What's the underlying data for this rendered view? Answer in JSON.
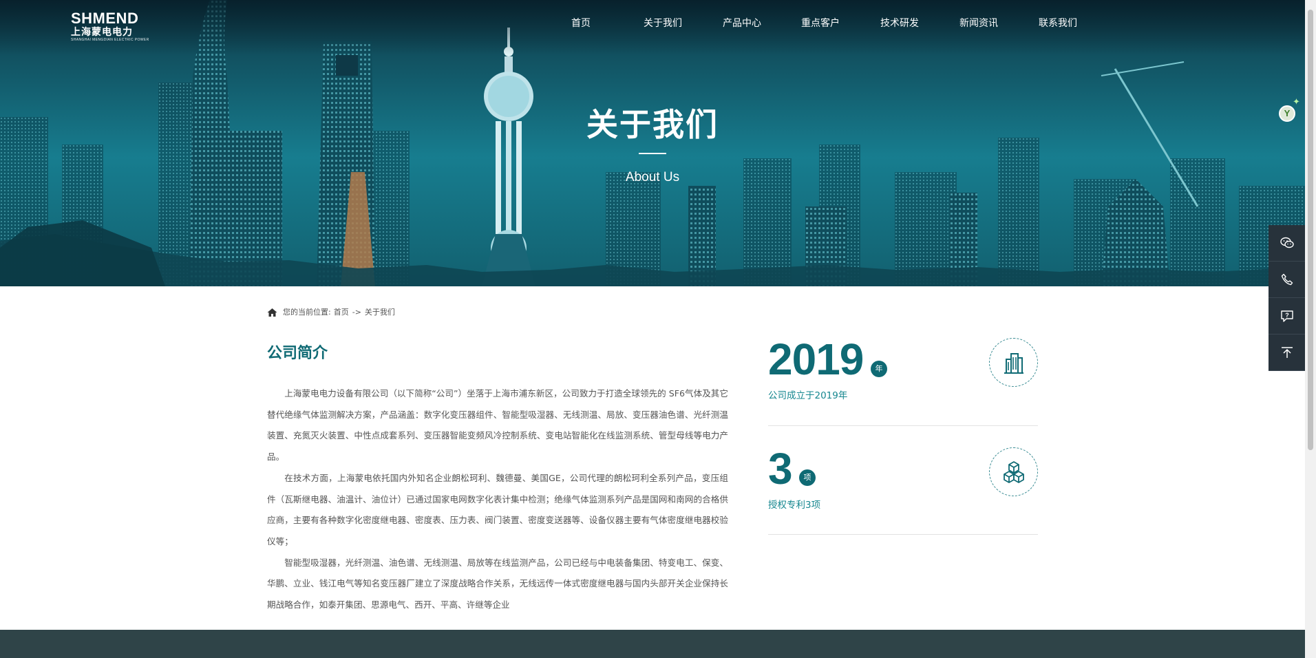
{
  "logo": {
    "name_en": "SHMEND",
    "name_cn": "上海蒙电电力",
    "subtitle": "SHANGHAI MENGDIAN ELECTRIC POWER"
  },
  "nav": {
    "items": [
      "首页",
      "关于我们",
      "产品中心",
      "重点客户",
      "技术研发",
      "新闻资讯",
      "联系我们"
    ]
  },
  "hero": {
    "title": "关于我们",
    "subtitle": "About Us"
  },
  "assistant_badge": {
    "letter": "Y",
    "sparkle": "✦"
  },
  "breadcrumb": {
    "prefix": "您的当前位置:",
    "home": "首页",
    "separator": "->",
    "current": "关于我们"
  },
  "intro": {
    "title": "公司简介",
    "paragraphs": [
      "上海蒙电电力设备有限公司（以下简称“公司”）坐落于上海市浦东新区，公司致力于打造全球领先的 SF6气体及其它替代绝缘气体监测解决方案，产品涵盖：数字化变压器组件、智能型吸湿器、无线测温、局放、变压器油色谱、光纤测温装置、充氮灭火装置、中性点成套系列、变压器智能变频风冷控制系统、变电站智能化在线监测系统、管型母线等电力产品。",
      "在技术方面，上海蒙电依托国内外知名企业朗松珂利、魏德曼、美国GE，公司代理的朗松珂利全系列产品，变压组件（瓦斯继电器、油温计、油位计）已通过国家电网数字化表计集中检测；绝缘气体监测系列产品是国网和南网的合格供应商，主要有各种数字化密度继电器、密度表、压力表、阀门装置、密度变送器等、设备仪器主要有气体密度继电器校验仪等；",
      "智能型吸湿器，光纤测温、油色谱、无线测温、局放等在线监测产品，公司已经与中电装备集团、特变电工、保变、华鹏、立业、钱江电气等知名变压器厂建立了深度战略合作关系，无线远传一体式密度继电器与国内头部开关企业保持长期战略合作，如泰开集团、思源电气、西开、平高、许继等企业"
    ]
  },
  "stats": [
    {
      "number": "2019",
      "unit": "年",
      "label": "公司成立于2019年",
      "icon": "building-icon"
    },
    {
      "number": "3",
      "unit": "项",
      "label": "授权专利3项",
      "icon": "cubes-icon"
    }
  ],
  "side_bar": {
    "buttons": [
      "wechat-icon",
      "phone-icon",
      "question-chat-icon",
      "back-to-top-icon"
    ]
  },
  "colors": {
    "brand": "#0f6a74",
    "stat_label": "#16878f",
    "side_bar_bg": "#27323b",
    "footer_bg": "#2f4448"
  }
}
